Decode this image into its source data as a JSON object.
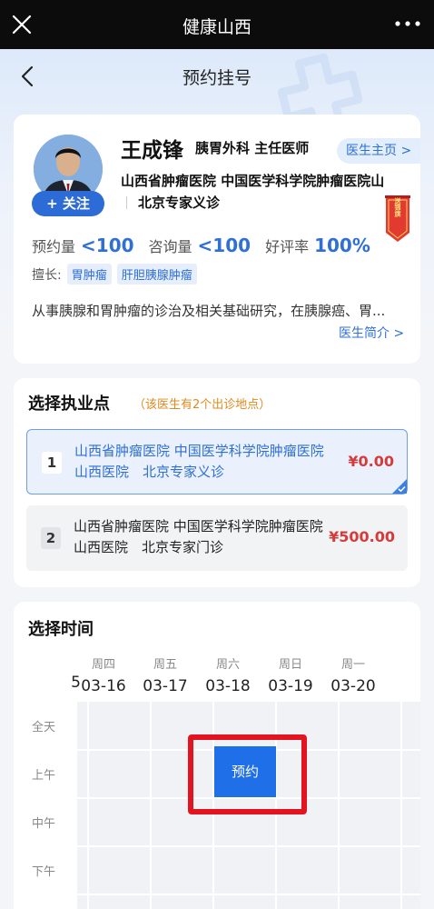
{
  "app": {
    "title": "健康山西"
  },
  "nav": {
    "title": "预约挂号"
  },
  "doctor": {
    "name": "王成锋",
    "title": "胰胃外科 主任医师",
    "home_link": "医生主页 >",
    "hospital_line1": "山西省肿瘤医院 中国医学科学院肿瘤医院山",
    "hospital_line2": "北京专家义诊",
    "follow_label": "+ 关注",
    "banner_text": "送锦旗",
    "stats": {
      "booking_label": "预约量",
      "booking_value": "<100",
      "consult_label": "咨询量",
      "consult_value": "<100",
      "rating_label": "好评率",
      "rating_value": "100%"
    },
    "specialty_label": "擅长:",
    "specialty_tags": [
      "胃肿瘤",
      "肝胆胰腺肿瘤"
    ],
    "bio": "从事胰腺和胃肿瘤的诊治及相关基础研究，在胰腺癌、胃...",
    "bio_link": "医生简介 >"
  },
  "locations": {
    "title": "选择执业点",
    "hint": "（该医生有2个出诊地点）",
    "options": [
      {
        "num": "1",
        "text": "山西省肿瘤医院 中国医学科学院肿瘤医院山西医院　北京专家义诊",
        "price": "¥0.00",
        "selected": true
      },
      {
        "num": "2",
        "text": "山西省肿瘤医院 中国医学科学院肿瘤医院山西医院　北京专家门诊",
        "price": "¥500.00",
        "selected": false
      }
    ]
  },
  "schedule": {
    "title": "选择时间",
    "partial_date": "5",
    "days": [
      {
        "weekday": "周四",
        "date": "03-16"
      },
      {
        "weekday": "周五",
        "date": "03-17"
      },
      {
        "weekday": "周六",
        "date": "03-18"
      },
      {
        "weekday": "周日",
        "date": "03-19"
      },
      {
        "weekday": "周一",
        "date": "03-20"
      }
    ],
    "slots": [
      "全天",
      "上午",
      "中午",
      "下午"
    ],
    "book_label": "预约"
  },
  "colors": {
    "accent": "#2f6fd6",
    "price": "#d63b3b",
    "highlight": "#e3141f",
    "hint": "#e08a1e"
  }
}
